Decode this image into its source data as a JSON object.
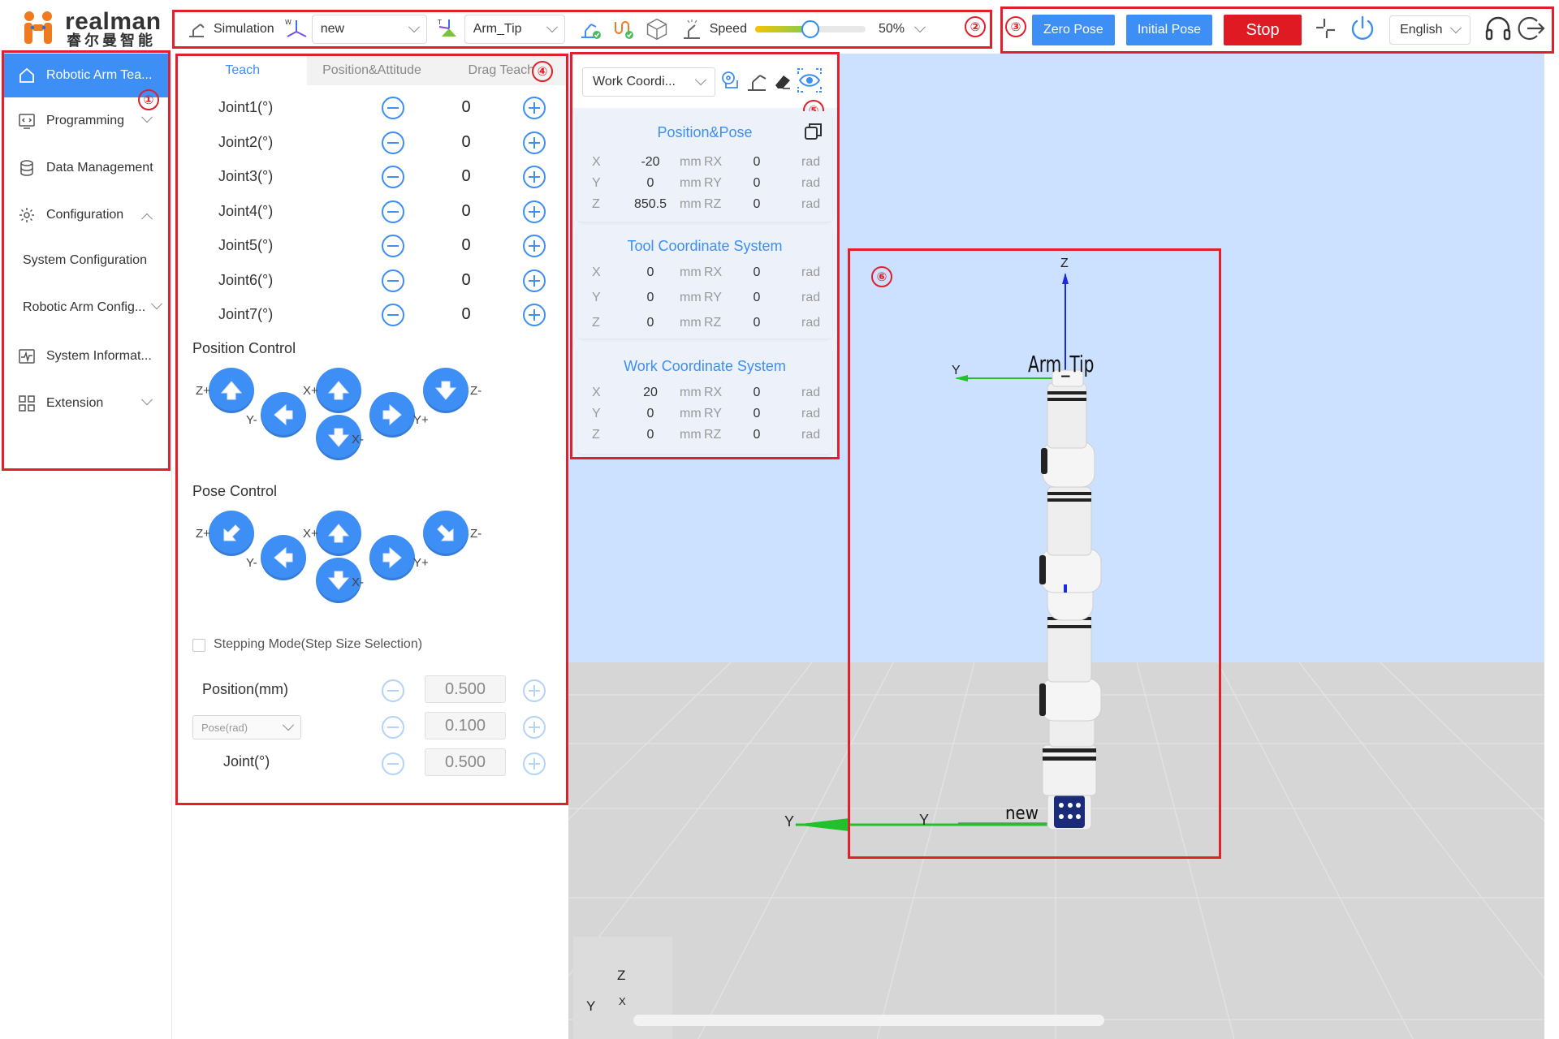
{
  "brand": {
    "name_en": "realman",
    "name_cn": "睿尔曼智能",
    "colors": {
      "accent": "#3d8ef5",
      "danger": "#e01a22",
      "annotation": "#e0202a",
      "logo": "#f07a20"
    }
  },
  "toolbar": {
    "mode_label": "Simulation",
    "frame_select": "new",
    "tool_select": "Arm_Tip",
    "speed_label": "Speed",
    "speed_value": "50%",
    "speed_fraction": 0.5
  },
  "actions": {
    "zero_pose": "Zero Pose",
    "initial_pose": "Initial Pose",
    "stop": "Stop",
    "language": "English"
  },
  "sidebar": {
    "items": [
      {
        "label": "Robotic Arm Tea..."
      },
      {
        "label": "Programming"
      },
      {
        "label": "Data Management"
      },
      {
        "label": "Configuration"
      },
      {
        "label": "System Configuration"
      },
      {
        "label": "Robotic Arm Config..."
      },
      {
        "label": "System Informat..."
      },
      {
        "label": "Extension"
      }
    ]
  },
  "badges": [
    "①",
    "②",
    "③",
    "④",
    "⑤",
    "⑥"
  ],
  "teach": {
    "tabs": [
      "Teach",
      "Position&Attitude",
      "Drag Teach"
    ],
    "joints": [
      {
        "label": "Joint1(°)",
        "value": "0"
      },
      {
        "label": "Joint2(°)",
        "value": "0"
      },
      {
        "label": "Joint3(°)",
        "value": "0"
      },
      {
        "label": "Joint4(°)",
        "value": "0"
      },
      {
        "label": "Joint5(°)",
        "value": "0"
      },
      {
        "label": "Joint6(°)",
        "value": "0"
      },
      {
        "label": "Joint7(°)",
        "value": "0"
      }
    ],
    "position_control": "Position Control",
    "pose_control": "Pose Control",
    "axis_labels": {
      "zp": "Z+",
      "zm": "Z-",
      "xp": "X+",
      "xm": "X-",
      "yp": "Y+",
      "ym": "Y-"
    },
    "stepping_mode": "Stepping Mode(Step Size Selection)",
    "steps": {
      "position_label": "Position(mm)",
      "position_value": "0.500",
      "pose_select": "Pose(rad)",
      "pose_value": "0.100",
      "joint_label": "Joint(°)",
      "joint_value": "0.500"
    }
  },
  "coord": {
    "select": "Work Coordi...",
    "cards": [
      {
        "title": "Position&Pose",
        "rows": [
          {
            "ax": "X",
            "v1": "-20",
            "u1": "mm",
            "ax2": "RX",
            "v2": "0",
            "u2": "rad"
          },
          {
            "ax": "Y",
            "v1": "0",
            "u1": "mm",
            "ax2": "RY",
            "v2": "0",
            "u2": "rad"
          },
          {
            "ax": "Z",
            "v1": "850.5",
            "u1": "mm",
            "ax2": "RZ",
            "v2": "0",
            "u2": "rad"
          }
        ]
      },
      {
        "title": "Tool Coordinate System",
        "rows": [
          {
            "ax": "X",
            "v1": "0",
            "u1": "mm",
            "ax2": "RX",
            "v2": "0",
            "u2": "rad"
          },
          {
            "ax": "Y",
            "v1": "0",
            "u1": "mm",
            "ax2": "RY",
            "v2": "0",
            "u2": "rad"
          },
          {
            "ax": "Z",
            "v1": "0",
            "u1": "mm",
            "ax2": "RZ",
            "v2": "0",
            "u2": "rad"
          }
        ]
      },
      {
        "title": "Work Coordinate System",
        "rows": [
          {
            "ax": "X",
            "v1": "20",
            "u1": "mm",
            "ax2": "RX",
            "v2": "0",
            "u2": "rad"
          },
          {
            "ax": "Y",
            "v1": "0",
            "u1": "mm",
            "ax2": "RY",
            "v2": "0",
            "u2": "rad"
          },
          {
            "ax": "Z",
            "v1": "0",
            "u1": "mm",
            "ax2": "RZ",
            "v2": "0",
            "u2": "rad"
          }
        ]
      }
    ]
  },
  "scene": {
    "tip_label": "Arm_Tip",
    "base_label": "new",
    "axis_z": "Z",
    "axis_y": "Y",
    "axis_x": "X"
  }
}
